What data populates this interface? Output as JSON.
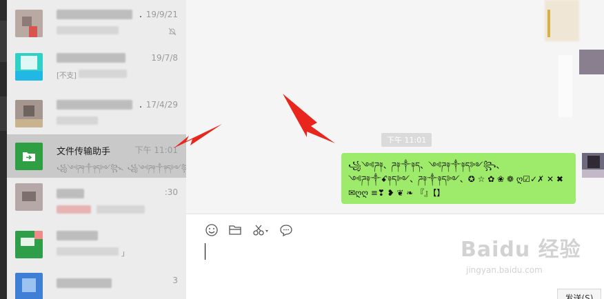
{
  "colors": {
    "accent_green": "#9eea6a",
    "file_helper_green": "#2ea043",
    "arrow_red": "#e8261d",
    "selected_bg": "#c9c9c9"
  },
  "chat_list": {
    "items": [
      {
        "time": "19/9/21",
        "name_suffix": ".",
        "muted": true
      },
      {
        "time": "19/7/8",
        "preview_fragment": "[不支]"
      },
      {
        "time": "17/4/29",
        "name_suffix": "."
      },
      {
        "name": "文件传输助手",
        "time": "下午 11:01",
        "preview": "꧁༺ཌ༈༒༈ད༻꧂、꧁༺ཌ༈༒༈ད༻꧂",
        "selected": true
      },
      {
        "time": ":30"
      },
      {
        "preview_fragment": "」"
      },
      {
        "time": "3"
      }
    ]
  },
  "chat": {
    "time_label": "下午 11:01",
    "message": "꧁༺ཌ༈、ཌ༈༒༈ད、༺ཌ༈༒༈ད༻꧂、༺ཌ༈༒ꗃ༈ད༻、ཌ༈༒༈ད༻、✪ ☆ ✿ ❀ ❁ ღ☑✓✗ ✕ ✖ ✉ღღ ≡❣ ❥ ❦ ❧ 『』【】"
  },
  "composer": {
    "toolbar": [
      {
        "icon": "emoji-icon"
      },
      {
        "icon": "folder-icon"
      },
      {
        "icon": "scissors-icon"
      },
      {
        "icon": "chat-bubble-icon"
      }
    ],
    "send_label": "发送(S)"
  },
  "watermark": {
    "main": "Baidu 经验",
    "sub": "jingyan.baidu.com"
  }
}
